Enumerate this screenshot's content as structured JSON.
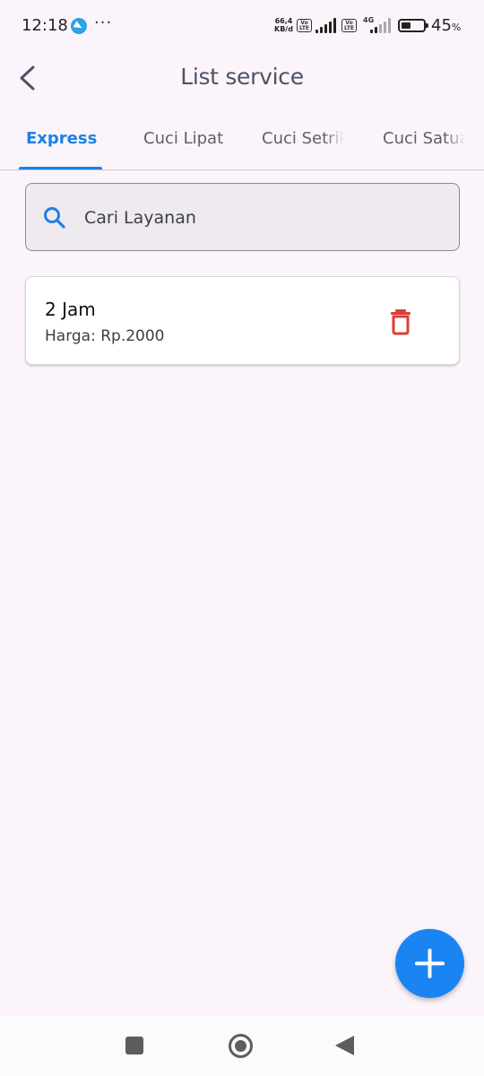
{
  "status_bar": {
    "time": "12:18",
    "net_speed_value": "66,4",
    "net_speed_unit": "KB/d",
    "volte_label": "Vo LTE",
    "network_type": "4G",
    "battery_percent": "45",
    "battery_unit": "%",
    "battery_level": 0.45
  },
  "app_bar": {
    "title": "List service",
    "back_icon": "chevron-left-icon"
  },
  "tabs": [
    {
      "label": "Express",
      "active": true
    },
    {
      "label": "Cuci Lipat",
      "active": false
    },
    {
      "label": "Cuci Setrika",
      "active": false
    },
    {
      "label": "Cuci Satuan",
      "active": false
    }
  ],
  "search": {
    "placeholder": "Cari Layanan",
    "icon": "search-icon"
  },
  "services": [
    {
      "name": "2 Jam",
      "price": "Harga: Rp.2000",
      "delete_icon": "trash-icon"
    }
  ],
  "fab": {
    "icon": "plus-icon"
  },
  "colors": {
    "accent": "#1d80e6",
    "fab": "#1a84f2",
    "delete": "#d8413a",
    "background": "#fcf4fb"
  }
}
